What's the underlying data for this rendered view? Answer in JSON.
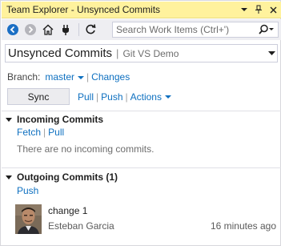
{
  "window": {
    "title": "Team Explorer - Unsynced Commits",
    "accent_color": "#fff29d"
  },
  "toolbar": {
    "icons": [
      "back-arrow-icon",
      "forward-arrow-icon",
      "home-icon",
      "connect-plug-icon",
      "refresh-icon"
    ],
    "search_placeholder": "Search Work Items (Ctrl+')"
  },
  "page": {
    "title": "Unsynced Commits",
    "divider": "|",
    "subtitle": "Git VS Demo"
  },
  "branch": {
    "label": "Branch:",
    "name": "master",
    "changes_link": "Changes"
  },
  "actions": {
    "sync_label": "Sync",
    "pull_label": "Pull",
    "push_label": "Push",
    "actions_label": "Actions"
  },
  "incoming": {
    "header": "Incoming Commits",
    "fetch_label": "Fetch",
    "pull_label": "Pull",
    "empty_message": "There are no incoming commits."
  },
  "outgoing": {
    "header": "Outgoing Commits (1)",
    "push_label": "Push",
    "commits": [
      {
        "message": "change 1",
        "author": "Esteban Garcia",
        "time": "16 minutes ago"
      }
    ]
  }
}
